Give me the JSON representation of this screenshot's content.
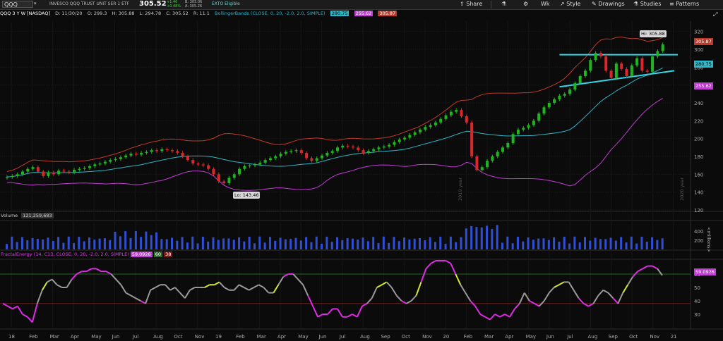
{
  "toolbar": {
    "symbol": "QQQ",
    "description": "INVESCO QQQ TRUST UNIT SER 1 ETF",
    "last_price": "305.52",
    "change": "+1.46",
    "change_pct": "+0.48%",
    "bid": "B: 305.06",
    "ask": "A: 305.26",
    "exto": "EXTO Eligible",
    "share": "Share",
    "timeframe": "Wk",
    "style": "Style",
    "drawings": "Drawings",
    "studies": "Studies",
    "patterns": "Patterns"
  },
  "infobar": {
    "title": "QQQ 3 Y W [NASDAQ]",
    "date": "D: 11/30/20",
    "open": "O: 299.3",
    "high": "H: 305.88",
    "low": "L: 294.78",
    "close": "C: 305.52",
    "range": "R: 11.1",
    "study": "BollingerBands (CLOSE, 0, 20, -2.0, 2.0, SIMPLE)",
    "mid": "280.75",
    "lower": "255.62",
    "upper": "305.87"
  },
  "volume_panel": {
    "label": "Volume",
    "value": "121,259,683",
    "unit": "<millions>"
  },
  "fe_panel": {
    "label": "FractalEnergy (14, C13, CLOSE, 0, 20, -2.0, 2.0, SIMPLE)",
    "value": "59.0926",
    "v60": "60",
    "v38": "38"
  },
  "annotations": {
    "hi": "Hi: 305.88",
    "lo": "Lo: 143.46",
    "year2019": "2019 year",
    "year2020": "2020 year"
  },
  "colors": {
    "up": "#1fb51f",
    "down": "#d9282c",
    "upper_band": "#c0392b",
    "mid_band": "#2ab7c9",
    "lower_band": "#c23bd4",
    "volume": "#2f4fd6",
    "trendline": "#33d6e8"
  },
  "chart_data": [
    {
      "type": "candlestick",
      "title": "QQQ 3 Y W [NASDAQ]",
      "ylim": [
        120,
        330
      ],
      "y_ticks": [
        120,
        140,
        160,
        180,
        200,
        220,
        240,
        260,
        280,
        300,
        320
      ],
      "x_ticks": [
        "18",
        "Feb",
        "Mar",
        "Apr",
        "May",
        "Jun",
        "Jul",
        "Aug",
        "Oct",
        "Nov",
        "19",
        "Feb",
        "Mar",
        "Apr",
        "May",
        "Jun",
        "Jul",
        "Aug",
        "Sep",
        "Oct",
        "Nov",
        "20",
        "Feb",
        "Mar",
        "Apr",
        "May",
        "Jun",
        "Jul",
        "Aug",
        "Sep",
        "Oct",
        "Nov",
        "21"
      ],
      "high": 305.88,
      "low": 143.46,
      "close_series": [
        157,
        158,
        160,
        163,
        166,
        168,
        163,
        158,
        162,
        160,
        164,
        163,
        162,
        165,
        166,
        167,
        169,
        171,
        172,
        174,
        176,
        177,
        179,
        181,
        183,
        182,
        184,
        185,
        187,
        186,
        188,
        187,
        186,
        184,
        180,
        176,
        172,
        171,
        170,
        166,
        160,
        152,
        150,
        156,
        160,
        166,
        169,
        170,
        171,
        173,
        176,
        178,
        180,
        183,
        185,
        186,
        187,
        184,
        178,
        175,
        178,
        181,
        184,
        186,
        190,
        192,
        191,
        190,
        187,
        184,
        186,
        188,
        190,
        191,
        193,
        196,
        199,
        201,
        204,
        207,
        210,
        213,
        215,
        218,
        222,
        226,
        230,
        232,
        225,
        218,
        180,
        165,
        168,
        175,
        180,
        185,
        190,
        195,
        205,
        210,
        212,
        215,
        220,
        228,
        235,
        240,
        244,
        248,
        250,
        255,
        262,
        270,
        276,
        288,
        296,
        292,
        276,
        268,
        284,
        278,
        270,
        282,
        290,
        276,
        275,
        292,
        298,
        305.52
      ],
      "bollinger": {
        "upper": 305.87,
        "mid": 280.75,
        "lower": 255.62
      }
    },
    {
      "type": "bar",
      "title": "Volume",
      "ylabel": "<millions>",
      "ylim": [
        0,
        600
      ],
      "y_ticks": [
        200,
        400
      ]
    },
    {
      "type": "line",
      "title": "FractalEnergy",
      "ylim": [
        20,
        70
      ],
      "y_ticks": [
        30,
        40,
        50,
        60
      ],
      "values": [
        38,
        36,
        34,
        36,
        30,
        28,
        24,
        38,
        48,
        54,
        56,
        52,
        50,
        50,
        56,
        60,
        62,
        62,
        64,
        64,
        62,
        62,
        60,
        56,
        52,
        46,
        44,
        42,
        40,
        38,
        48,
        50,
        52,
        52,
        48,
        50,
        46,
        42,
        48,
        50,
        50,
        50,
        52,
        52,
        54,
        50,
        48,
        48,
        52,
        50,
        48,
        50,
        52,
        50,
        46,
        46,
        52,
        58,
        60,
        60,
        56,
        52,
        44,
        36,
        28,
        30,
        30,
        34,
        34,
        28,
        28,
        30,
        28,
        36,
        38,
        42,
        50,
        52,
        54,
        50,
        44,
        40,
        38,
        40,
        44,
        54,
        64,
        68,
        70,
        70,
        70,
        68,
        60,
        52,
        46,
        40,
        36,
        30,
        28,
        26,
        30,
        28,
        30,
        28,
        34,
        38,
        46,
        40,
        38,
        36,
        40,
        46,
        50,
        52,
        54,
        54,
        48,
        42,
        38,
        36,
        38,
        44,
        48,
        46,
        42,
        38,
        46,
        52,
        58,
        62,
        64,
        66,
        66,
        64,
        59.09
      ]
    }
  ]
}
